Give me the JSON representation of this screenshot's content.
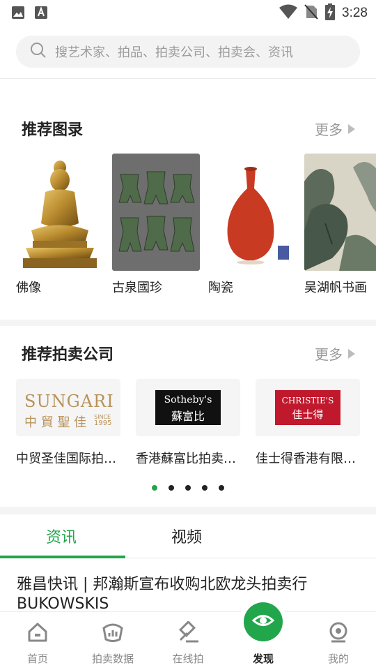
{
  "status_bar": {
    "time": "3:28",
    "icons": [
      "image-icon",
      "text-icon",
      "wifi-icon",
      "no-sim-icon",
      "battery-charging-icon"
    ]
  },
  "search": {
    "placeholder": "搜艺术家、拍品、拍卖公司、拍卖会、资讯"
  },
  "catalog_section": {
    "title": "推荐图录",
    "more": "更多",
    "items": [
      {
        "label": "佛像"
      },
      {
        "label": "古泉國珍"
      },
      {
        "label": "陶瓷"
      },
      {
        "label": "吴湖帆书画"
      }
    ]
  },
  "company_section": {
    "title": "推荐拍卖公司",
    "more": "更多",
    "items": [
      {
        "name": "中贸圣佳国际拍卖有限公司",
        "logo_line1": "SUNGARI",
        "logo_line2": "中 貿 聖 佳",
        "logo_since": "SINCE",
        "logo_year": "1995"
      },
      {
        "name": "香港蘇富比拍卖有限公司",
        "logo_line1": "Sotheby's",
        "logo_line2": "蘇富比"
      },
      {
        "name": "佳士得香港有限公司",
        "logo_line1": "CHRISTIE'S",
        "logo_line2": "佳士得"
      }
    ],
    "page_indicator": {
      "count": 5,
      "active": 1
    }
  },
  "tabs": [
    {
      "label": "资讯",
      "active": true
    },
    {
      "label": "视频",
      "active": false
    }
  ],
  "news": [
    {
      "title": "雅昌快讯 | 邦瀚斯宣布收购北欧龙头拍卖行BUKOWSKIS"
    }
  ],
  "bottom_nav": [
    {
      "label": "首页",
      "icon": "home-icon"
    },
    {
      "label": "拍卖数据",
      "icon": "chart-icon"
    },
    {
      "label": "在线拍",
      "icon": "gavel-icon"
    },
    {
      "label": "发现",
      "icon": "eye-icon",
      "active": true
    },
    {
      "label": "我的",
      "icon": "profile-icon"
    }
  ],
  "colors": {
    "accent": "#22a64c",
    "sotheby_bg": "#111111",
    "christie_bg": "#c0182c",
    "sungari_gold": "#b8925a"
  }
}
